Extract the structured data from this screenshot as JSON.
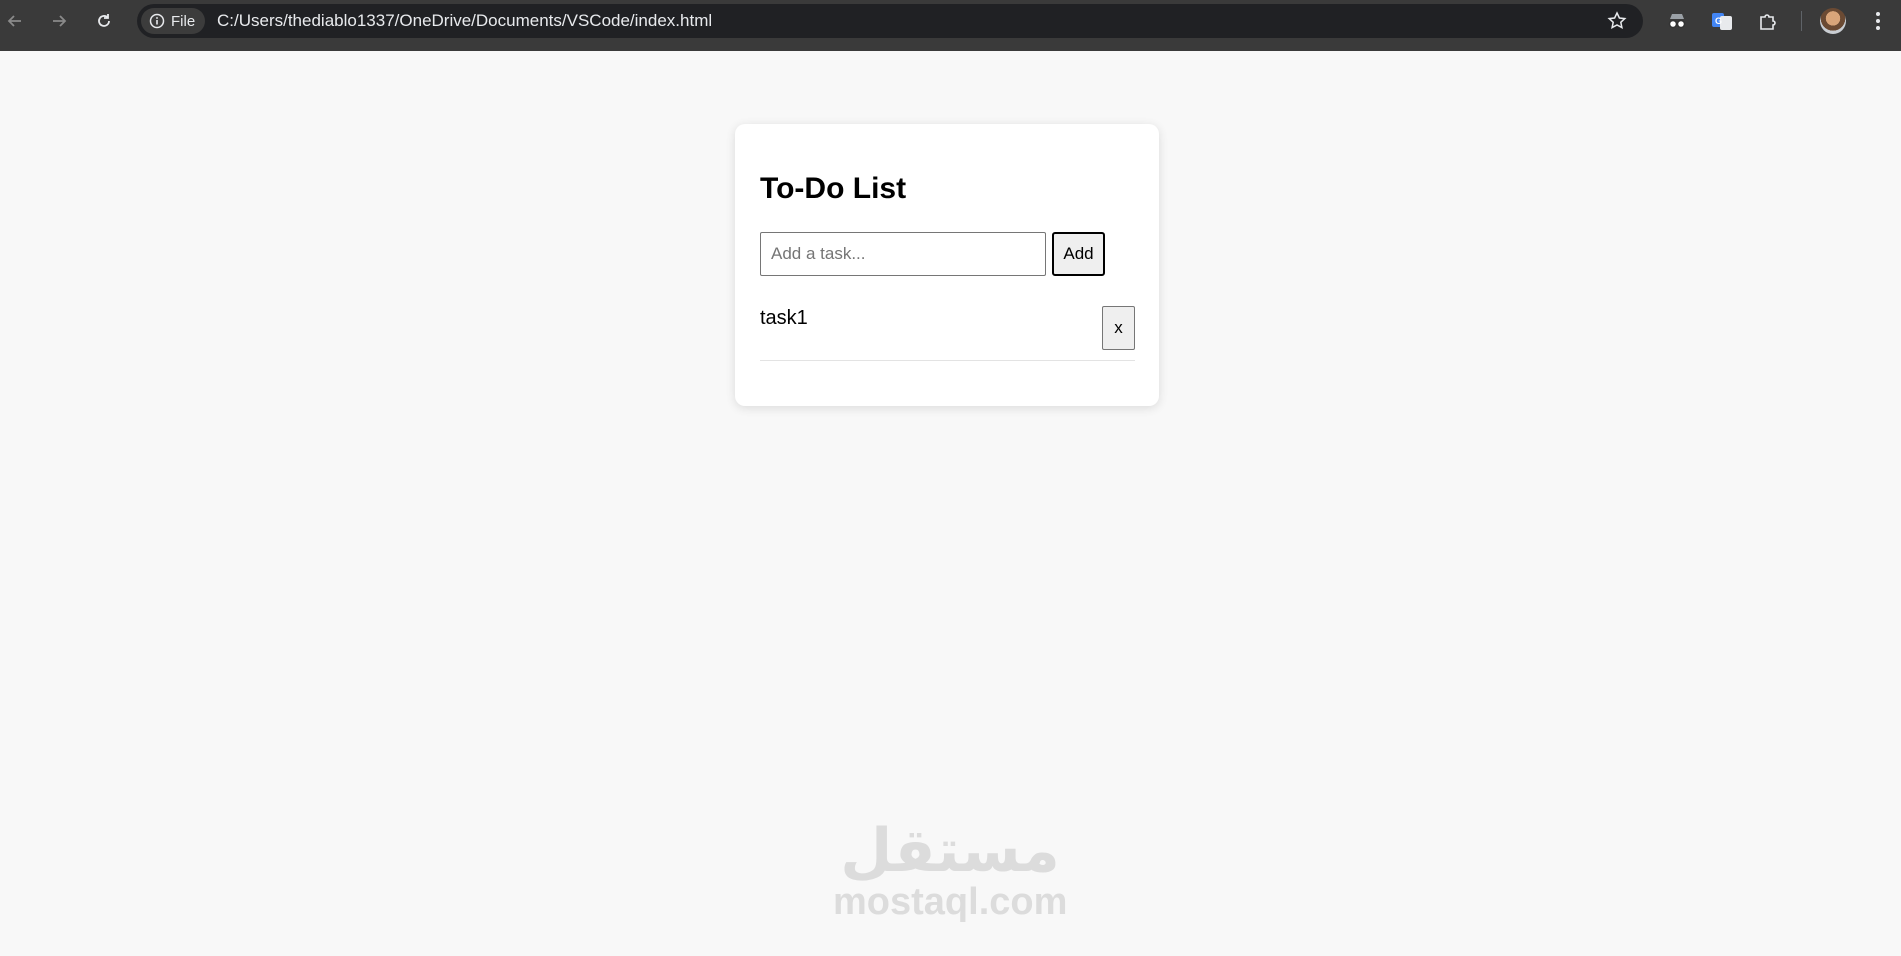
{
  "browser": {
    "url": "C:/Users/thediablo1337/OneDrive/Documents/VSCode/index.html",
    "scheme_chip": "File"
  },
  "app": {
    "title": "To-Do List",
    "input": {
      "placeholder": "Add a task...",
      "value": ""
    },
    "add_label": "Add",
    "tasks": [
      {
        "text": "task1",
        "delete_label": "x"
      }
    ]
  },
  "watermark": {
    "arabic": "مستقل",
    "latin": "mostaql.com"
  }
}
